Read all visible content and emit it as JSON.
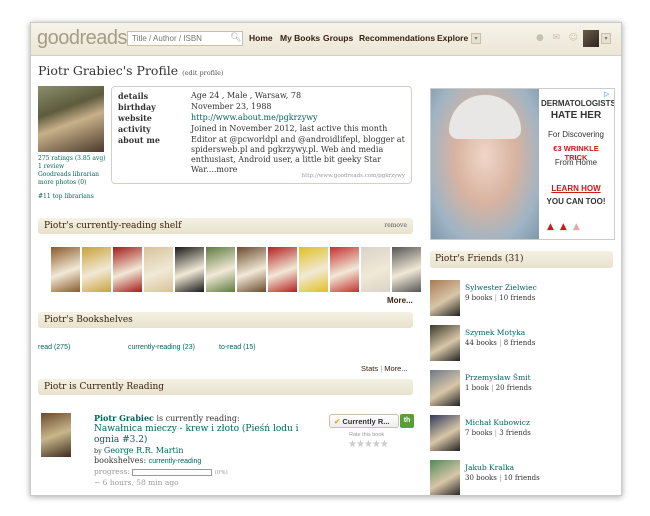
{
  "header": {
    "logo": "goodreads",
    "search_placeholder": "Title / Author / ISBN",
    "nav": [
      "Home",
      "My Books",
      "Groups",
      "Recommendations",
      "Explore"
    ]
  },
  "profile": {
    "name": "Piotr Grabiec's Profile",
    "edit_link": "(edit profile)",
    "ratings": "275 ratings (3.85 avg)",
    "reviews": "1 review",
    "librarian": "Goodreads librarian",
    "more_photos": "more photos (0)",
    "top_librarians": "#11 top librarians"
  },
  "details": [
    {
      "label": "details",
      "value": "Age 24 , Male , Warsaw, 78"
    },
    {
      "label": "birthday",
      "value": "November 23, 1988"
    },
    {
      "label": "website",
      "value": "http://www.about.me/pgkrzywy"
    },
    {
      "label": "activity",
      "value": "Joined in November 2012, last active this month"
    },
    {
      "label": "about me",
      "value": "Editor at @pcworldpl and @androidlifepl, blogger at spidersweb.pl and pgkrzywy.pl. Web and media enthusiast, Android user, a little bit geeky Star War....more"
    }
  ],
  "details_url": "http://www.goodreads.com/pgkrzywy",
  "currently_reading_shelf": {
    "title": "Piotr's currently-reading shelf",
    "remove": "remove",
    "more": "More...",
    "book_colors": [
      "#8b5a2b",
      "#c9a23a",
      "#a31b1b",
      "#d7c39a",
      "#1a1a1a",
      "#5e7a3f",
      "#6b4a2e",
      "#b32020",
      "#e0c020",
      "#c43030",
      "#d9d3c8",
      "#555555"
    ]
  },
  "bookshelves": {
    "title": "Piotr's Bookshelves",
    "items": [
      "read (275)",
      "currently-reading (23)",
      "to-read (15)"
    ],
    "stats": "Stats",
    "sep": "|",
    "more": "More..."
  },
  "currently_reading": {
    "title": "Piotr is Currently Reading",
    "user": "Piotr Grabiec",
    "status": "is currently reading:",
    "book_title": "Nawałnica mieczy - krew i złoto (Pieśń lodu i ognia #3.2)",
    "by": "by",
    "author": "George R.R. Martin",
    "shelves_label": "bookshelves:",
    "shelf": "currently-reading",
    "progress_label": "progress:",
    "progress_pct": "(0%)",
    "progress_value": 0,
    "time_ago": "~ 6 hours, 58 min ago",
    "button_label": "Currently R...",
    "rate_label": "Rate this book"
  },
  "ad": {
    "line1": "DERMATOLOGISTS",
    "line2": "HATE HER",
    "line3": "For Discovering",
    "line4": "€3 WRINKLE TRICK",
    "line5": "From Home",
    "line6": "LEARN HOW",
    "line7": "YOU CAN TOO!"
  },
  "friends": {
    "title": "Piotr's Friends (31)",
    "list": [
      {
        "name": "Sylwester Zielwiec",
        "books": "9 books",
        "friends": "10 friends",
        "color": "#a87a55"
      },
      {
        "name": "Szymek Motyka",
        "books": "44 books",
        "friends": "8 friends",
        "color": "#3a3a2a"
      },
      {
        "name": "Przemysław Śmit",
        "books": "1 book",
        "friends": "20 friends",
        "color": "#6d7a86"
      },
      {
        "name": "Michał Kubowicz",
        "books": "7 books",
        "friends": "3 friends",
        "color": "#2f3a5a"
      },
      {
        "name": "Jakub Kralka",
        "books": "30 books",
        "friends": "10 friends",
        "color": "#4f8a5a"
      }
    ]
  }
}
